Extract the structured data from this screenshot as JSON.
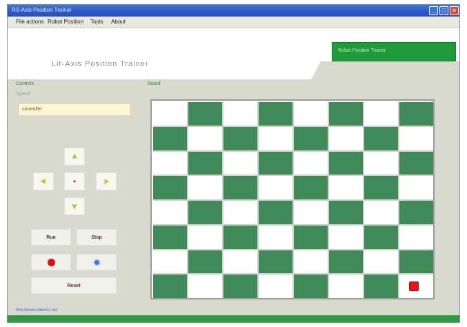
{
  "window": {
    "title": "RS-Axis Position Trainer",
    "controls": {
      "minimize": "_",
      "maximize": "□",
      "close": "×"
    }
  },
  "menu": {
    "items": [
      {
        "label": "File actions"
      },
      {
        "label": "Robot Position"
      },
      {
        "label": "Tools"
      },
      {
        "label": "About"
      }
    ]
  },
  "banner": {
    "app_title": "Lit-Axis Position Trainer",
    "green_panel_text": "Robot Position Trainer"
  },
  "control_panel": {
    "title": "Controls",
    "speed_label": "Speed",
    "speed_value": "controller",
    "pad": {
      "up_icon": "➤",
      "left_icon": "➤",
      "center_icon": "•",
      "right_icon": "➤",
      "down_icon": "➤"
    },
    "buttons": {
      "run_label": "Run",
      "stop_label": "Stop",
      "reset_label": "Reset"
    }
  },
  "board": {
    "title": "Board",
    "robot_position": {
      "row": 8,
      "col": 8
    },
    "cell_number_color": "#8a6a5a"
  },
  "status_bar": {
    "text": "http://www.robotics.net"
  },
  "colors": {
    "board_dark": "#3f8a58",
    "board_light": "#ffffff",
    "accent_green": "#1f9b3b",
    "robot": "#e01818"
  }
}
